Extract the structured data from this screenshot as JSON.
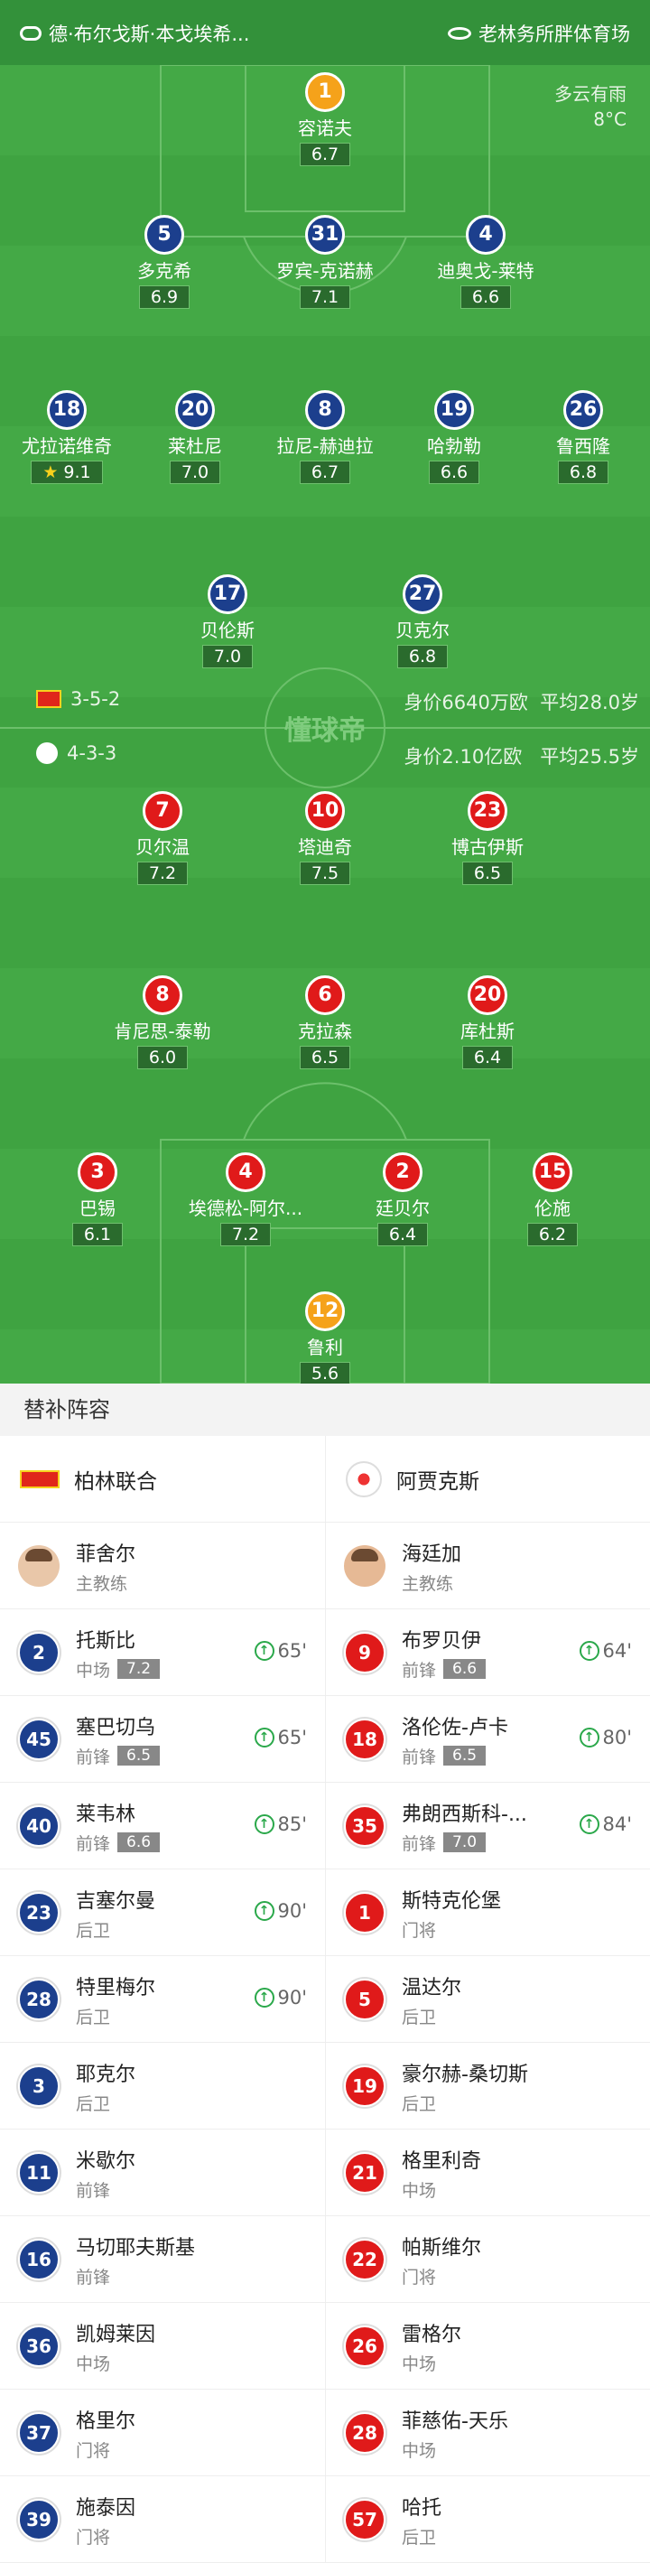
{
  "header": {
    "match_title": "德·布尔戈斯·本戈埃希...",
    "venue": "老林务所胖体育场"
  },
  "weather": {
    "condition": "多云有雨",
    "temperature": "8°C"
  },
  "home_formation": {
    "formation": "3-5-2",
    "value": "身价6640万欧",
    "avg_age": "平均28.0岁"
  },
  "away_formation": {
    "formation": "4-3-3",
    "value": "身价2.10亿欧",
    "avg_age": "平均25.5岁"
  },
  "watermark": "懂球帝",
  "home_players": [
    {
      "num": "1",
      "name": "容诺夫",
      "rating": "6.7",
      "color": "orange"
    },
    {
      "num": "5",
      "name": "多克希",
      "rating": "6.9",
      "color": "blue",
      "yellow": true,
      "goal": true
    },
    {
      "num": "31",
      "name": "罗宾-克诺赫",
      "rating": "7.1",
      "color": "blue",
      "goal": true
    },
    {
      "num": "4",
      "name": "迪奥戈-莱特",
      "rating": "6.6",
      "color": "blue"
    },
    {
      "num": "18",
      "name": "尤拉诺维奇",
      "rating": "9.1",
      "color": "blue",
      "sub": "90'",
      "goal": true,
      "assist": true,
      "star": true
    },
    {
      "num": "20",
      "name": "莱杜尼",
      "rating": "7.0",
      "color": "blue",
      "sub": "65'"
    },
    {
      "num": "8",
      "name": "拉尼-赫迪拉",
      "rating": "6.7",
      "color": "blue"
    },
    {
      "num": "19",
      "name": "哈勃勒",
      "rating": "6.6",
      "color": "blue",
      "assist": true
    },
    {
      "num": "26",
      "name": "鲁西隆",
      "rating": "6.8",
      "color": "blue",
      "sub": "90'"
    },
    {
      "num": "17",
      "name": "贝伦斯",
      "rating": "7.0",
      "color": "blue",
      "sub": "65'"
    },
    {
      "num": "27",
      "name": "贝克尔",
      "rating": "6.8",
      "color": "blue",
      "sub": "85'",
      "yellow_sub": true
    }
  ],
  "away_players": [
    {
      "num": "7",
      "name": "贝尔温",
      "rating": "7.2",
      "color": "red",
      "sub": "80'",
      "assist": true
    },
    {
      "num": "10",
      "name": "塔迪奇",
      "rating": "7.5",
      "color": "red",
      "yellow": true
    },
    {
      "num": "23",
      "name": "博古伊斯",
      "rating": "6.5",
      "color": "red",
      "yellow": true
    },
    {
      "num": "8",
      "name": "肯尼思-泰勒",
      "rating": "6.0",
      "color": "red"
    },
    {
      "num": "6",
      "name": "克拉森",
      "rating": "6.5",
      "color": "red",
      "sub": "64'",
      "yellow_sub": true
    },
    {
      "num": "20",
      "name": "库杜斯",
      "rating": "6.4",
      "color": "red",
      "yellow": true,
      "goal": true
    },
    {
      "num": "3",
      "name": "巴锡",
      "rating": "6.1",
      "color": "red"
    },
    {
      "num": "4",
      "name": "埃德松-阿尔...",
      "rating": "7.2",
      "color": "red",
      "red": true
    },
    {
      "num": "2",
      "name": "廷贝尔",
      "rating": "6.4",
      "color": "red"
    },
    {
      "num": "15",
      "name": "伦施",
      "rating": "6.2",
      "color": "red",
      "sub": "84'"
    },
    {
      "num": "12",
      "name": "鲁利",
      "rating": "5.6",
      "color": "orange"
    }
  ],
  "subs": {
    "title": "替补阵容",
    "home_team": "柏林联合",
    "away_team": "阿贾克斯",
    "home_coach": {
      "name": "菲舍尔",
      "role": "主教练"
    },
    "away_coach": {
      "name": "海廷加",
      "role": "主教练"
    },
    "home_list": [
      {
        "num": "2",
        "name": "托斯比",
        "pos": "中场",
        "rating": "7.2",
        "min": "65'"
      },
      {
        "num": "45",
        "name": "塞巴切乌",
        "pos": "前锋",
        "rating": "6.5",
        "min": "65'"
      },
      {
        "num": "40",
        "name": "莱韦林",
        "pos": "前锋",
        "rating": "6.6",
        "min": "85'"
      },
      {
        "num": "23",
        "name": "吉塞尔曼",
        "pos": "后卫",
        "rating": "",
        "min": "90'"
      },
      {
        "num": "28",
        "name": "特里梅尔",
        "pos": "后卫",
        "rating": "",
        "min": "90'"
      },
      {
        "num": "3",
        "name": "耶克尔",
        "pos": "后卫",
        "rating": "",
        "min": ""
      },
      {
        "num": "11",
        "name": "米歇尔",
        "pos": "前锋",
        "rating": "",
        "min": ""
      },
      {
        "num": "16",
        "name": "马切耶夫斯基",
        "pos": "前锋",
        "rating": "",
        "min": ""
      },
      {
        "num": "36",
        "name": "凯姆莱因",
        "pos": "中场",
        "rating": "",
        "min": ""
      },
      {
        "num": "37",
        "name": "格里尔",
        "pos": "门将",
        "rating": "",
        "min": ""
      },
      {
        "num": "39",
        "name": "施泰因",
        "pos": "门将",
        "rating": "",
        "min": ""
      }
    ],
    "away_list": [
      {
        "num": "9",
        "name": "布罗贝伊",
        "pos": "前锋",
        "rating": "6.6",
        "min": "64'"
      },
      {
        "num": "18",
        "name": "洛伦佐-卢卡",
        "pos": "前锋",
        "rating": "6.5",
        "min": "80'"
      },
      {
        "num": "35",
        "name": "弗朗西斯科-...",
        "pos": "前锋",
        "rating": "7.0",
        "min": "84'"
      },
      {
        "num": "1",
        "name": "斯特克伦堡",
        "pos": "门将",
        "rating": "",
        "min": ""
      },
      {
        "num": "5",
        "name": "温达尔",
        "pos": "后卫",
        "rating": "",
        "min": ""
      },
      {
        "num": "19",
        "name": "豪尔赫-桑切斯",
        "pos": "后卫",
        "rating": "",
        "min": ""
      },
      {
        "num": "21",
        "name": "格里利奇",
        "pos": "中场",
        "rating": "",
        "min": ""
      },
      {
        "num": "22",
        "name": "帕斯维尔",
        "pos": "门将",
        "rating": "",
        "min": ""
      },
      {
        "num": "26",
        "name": "雷格尔",
        "pos": "中场",
        "rating": "",
        "min": ""
      },
      {
        "num": "28",
        "name": "菲慈佑-天乐",
        "pos": "中场",
        "rating": "",
        "min": ""
      },
      {
        "num": "57",
        "name": "哈托",
        "pos": "后卫",
        "rating": "",
        "min": ""
      }
    ]
  }
}
